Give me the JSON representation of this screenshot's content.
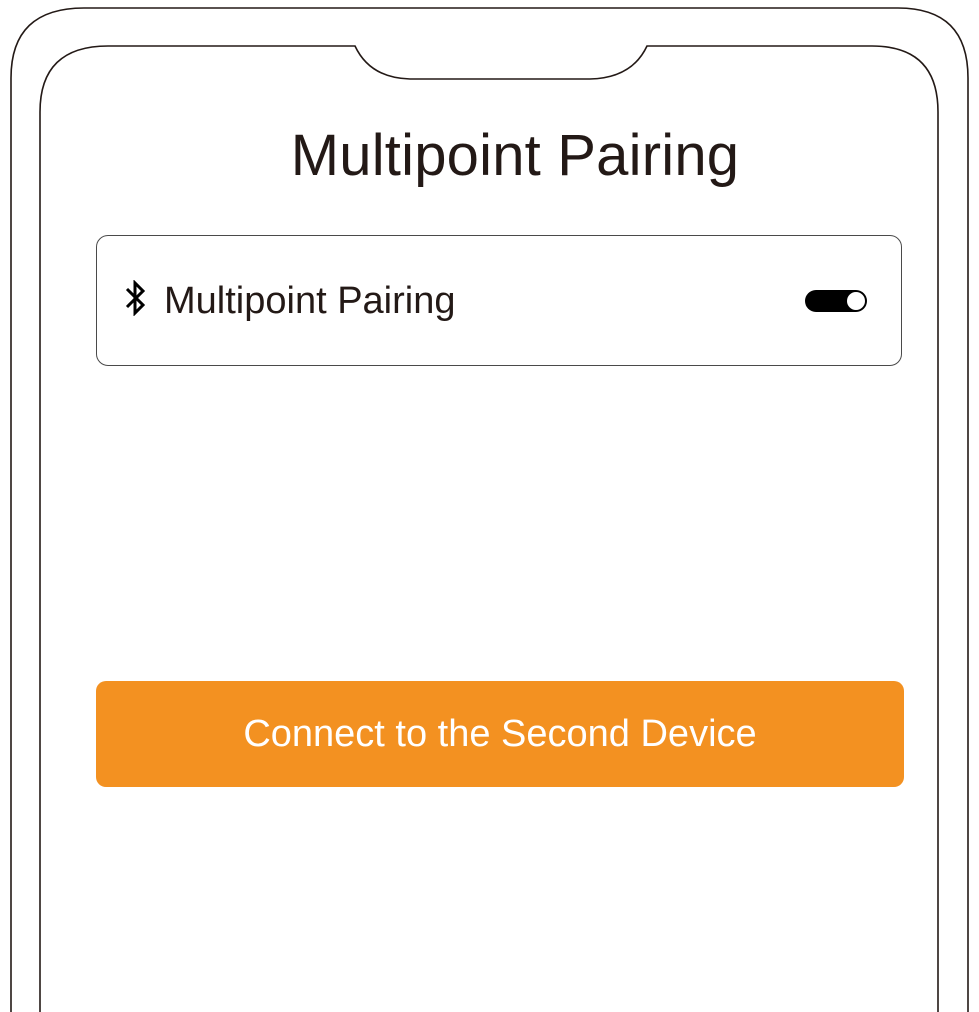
{
  "screen": {
    "title": "Multipoint Pairing"
  },
  "setting": {
    "icon": "bluetooth-icon",
    "label": "Multipoint Pairing",
    "toggle_state": "on"
  },
  "actions": {
    "connect_label": "Connect to the Second Device"
  },
  "colors": {
    "accent": "#f39121",
    "text": "#231916",
    "outline": "#231916"
  }
}
